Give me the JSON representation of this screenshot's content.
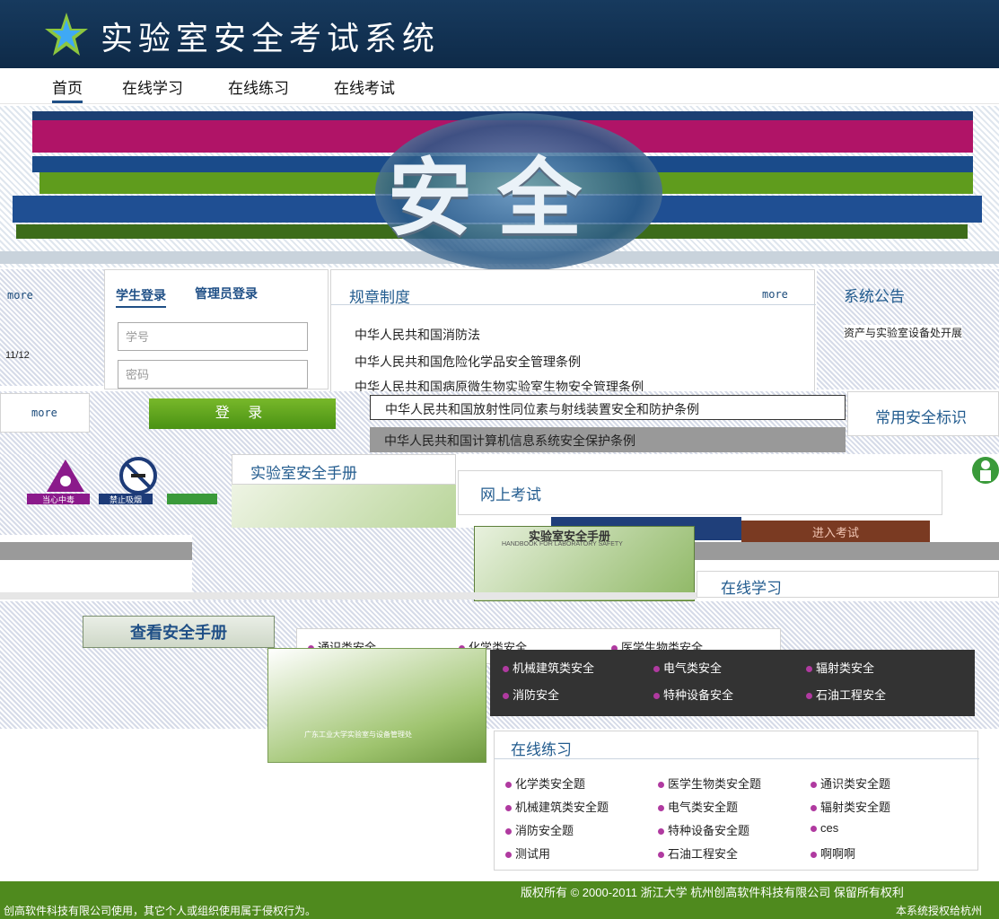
{
  "header": {
    "title": "实验室安全考试系统"
  },
  "nav": {
    "items": [
      "首页",
      "在线学习",
      "在线练习",
      "在线考试"
    ]
  },
  "banner": {
    "text": "安全"
  },
  "login": {
    "tab_student": "学生登录",
    "tab_admin": "管理员登录",
    "id_placeholder": "学号",
    "password_placeholder": "密码",
    "submit": "登 录"
  },
  "regulations": {
    "title": "规章制度",
    "more": "more",
    "items": [
      "中华人民共和国消防法",
      "中华人民共和国危险化学品安全管理条例",
      "中华人民共和国病原微生物实验室生物安全管理条例",
      "中华人民共和国放射性同位素与射线装置安全和防护条例",
      "中华人民共和国计算机信息系统安全保护条例"
    ]
  },
  "announcement": {
    "title": "系统公告",
    "item": "资产与实验室设备处开展"
  },
  "left_misc": {
    "more": "more",
    "date": "11/12"
  },
  "signs": {
    "title": "常用安全标识",
    "more": "more",
    "sign_labels": [
      "当心中毒",
      "禁止吸烟"
    ]
  },
  "handbook": {
    "title": "实验室安全手册",
    "cover_title": "实验室安全手册",
    "cover_subtitle": "HANDBOOK FOR LABORATORY SAFETY",
    "view_button": "查看安全手册",
    "cover_caption": "广东工业大学实验室与设备管理处"
  },
  "exam": {
    "title": "网上考试",
    "enter_button": "进入考试"
  },
  "online_study": {
    "title": "在线学习",
    "items": [
      "通识类安全",
      "化学类安全",
      "医学生物类安全",
      "机械建筑类安全",
      "电气类安全",
      "辐射类安全",
      "消防安全",
      "特种设备安全",
      "石油工程安全"
    ]
  },
  "online_practice": {
    "title": "在线练习",
    "items": [
      "化学类安全题",
      "医学生物类安全题",
      "通识类安全题",
      "机械建筑类安全题",
      "电气类安全题",
      "辐射类安全题",
      "消防安全题",
      "特种设备安全题",
      "ces",
      "测试用",
      "石油工程安全",
      "啊啊啊"
    ]
  },
  "footer": {
    "copyright": "版权所有 © 2000-2011   浙江大学   杭州创高软件科技有限公司   保留所有权利",
    "notice": "创高软件科技有限公司使用，其它个人或组织使用属于侵权行为。",
    "license": "本系统授权给杭州"
  },
  "colors": {
    "header": "#173a5e",
    "accent_green": "#4a9214",
    "footer": "#4f8a1e",
    "link_blue": "#235c8f"
  }
}
